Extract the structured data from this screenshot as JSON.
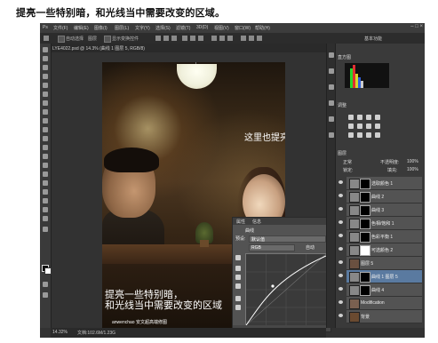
{
  "instruction": "提亮一些特别暗，和光线当中需要改变的区域。",
  "app": {
    "menus": [
      "文件(F)",
      "编辑(E)",
      "图像(I)",
      "图层(L)",
      "文字(Y)",
      "选择(S)",
      "滤镜(T)",
      "3D(D)",
      "视图(V)",
      "窗口(W)",
      "帮助(H)"
    ],
    "window_controls": "–  □  ×",
    "options": {
      "auto_select": "自动选择",
      "layer_label": "图层",
      "transform_controls": "显示变换控件"
    },
    "workspace_label": "基本功能",
    "document_tab": "LYE4022.psd @ 14.3% (曲线 1 图层 5, RGB/8)",
    "status_zoom": "14.32%",
    "status_doc": "文档:102.6M/1.23G"
  },
  "canvas": {
    "annotation_top": "这里也提亮了哦！",
    "annotation_bottom": [
      "提亮一些特别暗，",
      "和光线当中需要改变的区域"
    ],
    "watermark": "anwenchao 安文超高端修图"
  },
  "properties_panel": {
    "tabs": [
      "属性",
      "信息"
    ],
    "title": "曲线",
    "preset_label": "预设:",
    "preset_value": "默认值",
    "channel_value": "RGB",
    "auto_label": "自动"
  },
  "right_panel": {
    "histogram_tab": "直方图",
    "adjustments_tab": "调整",
    "layers_tab": "图层",
    "blend_mode": "正常",
    "opacity_label": "不透明度:",
    "opacity_value": "100%",
    "fill_label": "填充:",
    "fill_value": "100%",
    "lock_label": "锁定:",
    "layers": [
      {
        "name": "选取颜色 1",
        "mask": "black"
      },
      {
        "name": "曲线 2",
        "mask": "black"
      },
      {
        "name": "曲线 3",
        "mask": "black"
      },
      {
        "name": "色相/饱和 1",
        "mask": "black"
      },
      {
        "name": "色彩平衡 1",
        "mask": "black"
      },
      {
        "name": "可选颜色 2",
        "mask": "white"
      },
      {
        "name": "图层 5",
        "mask": "none"
      },
      {
        "name": "曲线 1 图层 5",
        "mask": "black",
        "selected": true
      },
      {
        "name": "曲线 4",
        "mask": "black"
      },
      {
        "name": "Modification",
        "mask": "none"
      },
      {
        "name": "背景",
        "mask": "none"
      }
    ]
  }
}
